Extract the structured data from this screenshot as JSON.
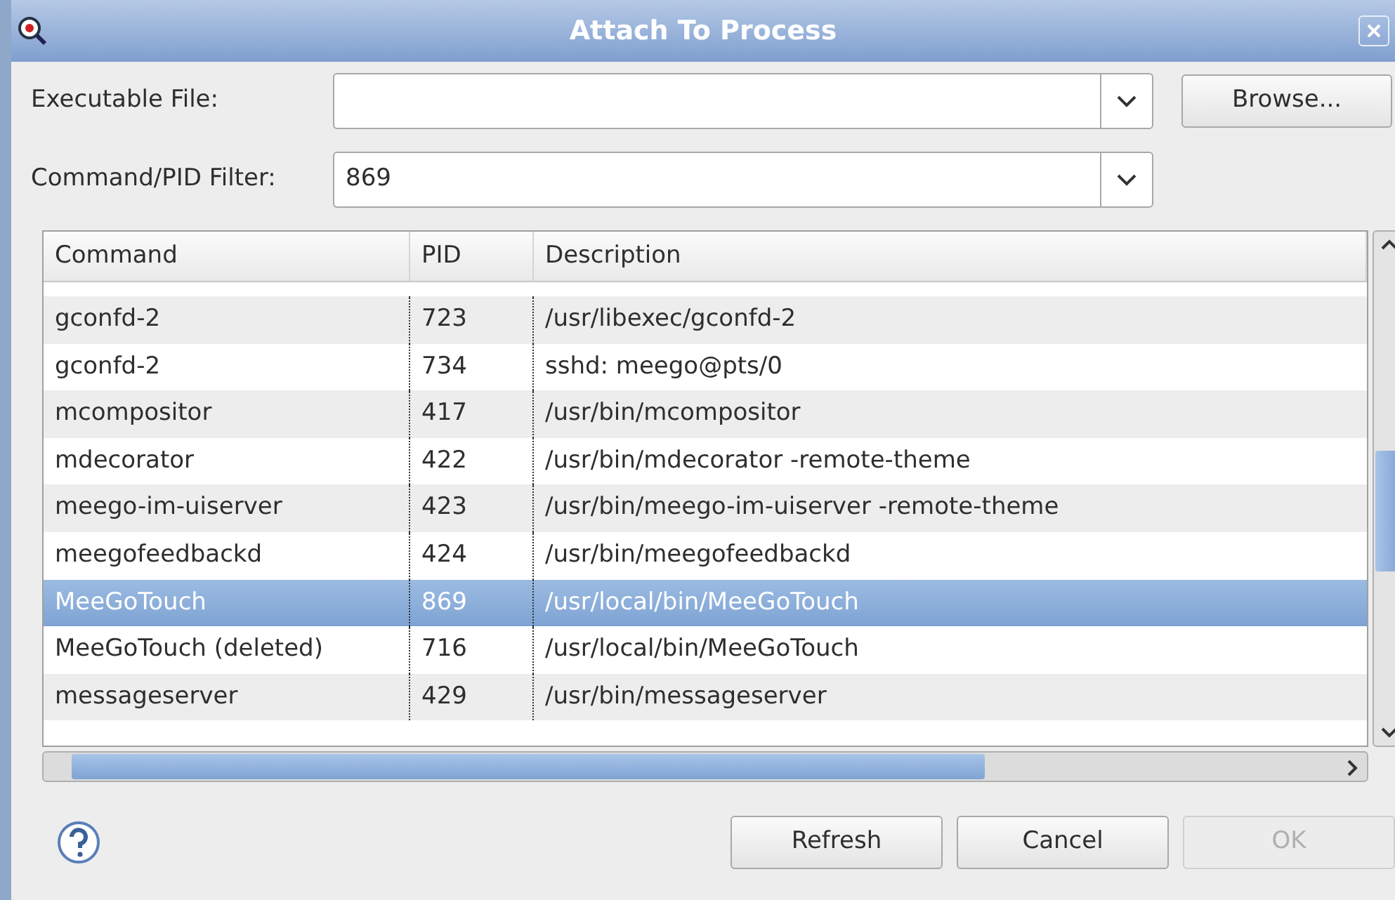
{
  "window": {
    "title": "Attach To Process"
  },
  "executable_file": {
    "label": "Executable File:"
  },
  "browse_button": {
    "label": "Browse..."
  },
  "filter": {
    "label": "Command/PID Filter:",
    "value": "869"
  },
  "table": {
    "columns": [
      "Command",
      "PID",
      "Description"
    ],
    "rows": [
      {
        "cells": [
          "gconfd-2",
          "723",
          "/usr/libexec/gconfd-2"
        ],
        "selected": false
      },
      {
        "cells": [
          "gconfd-2",
          "734",
          "sshd: meego@pts/0"
        ],
        "selected": false
      },
      {
        "cells": [
          "mcompositor",
          "417",
          "/usr/bin/mcompositor"
        ],
        "selected": false
      },
      {
        "cells": [
          "mdecorator",
          "422",
          "/usr/bin/mdecorator -remote-theme"
        ],
        "selected": false
      },
      {
        "cells": [
          "meego-im-uiserver",
          "423",
          "/usr/bin/meego-im-uiserver -remote-theme"
        ],
        "selected": false
      },
      {
        "cells": [
          "meegofeedbackd",
          "424",
          "/usr/bin/meegofeedbackd"
        ],
        "selected": false
      },
      {
        "cells": [
          "MeeGoTouch",
          "869",
          "/usr/local/bin/MeeGoTouch"
        ],
        "selected": true
      },
      {
        "cells": [
          "MeeGoTouch (deleted)",
          "716",
          "/usr/local/bin/MeeGoTouch"
        ],
        "selected": false
      },
      {
        "cells": [
          "messageserver",
          "429",
          "/usr/bin/messageserver"
        ],
        "selected": false
      }
    ]
  },
  "buttons": [
    {
      "label": "Refresh",
      "disabled": false
    },
    {
      "label": "Cancel",
      "disabled": false
    },
    {
      "label": "OK",
      "disabled": true
    }
  ]
}
